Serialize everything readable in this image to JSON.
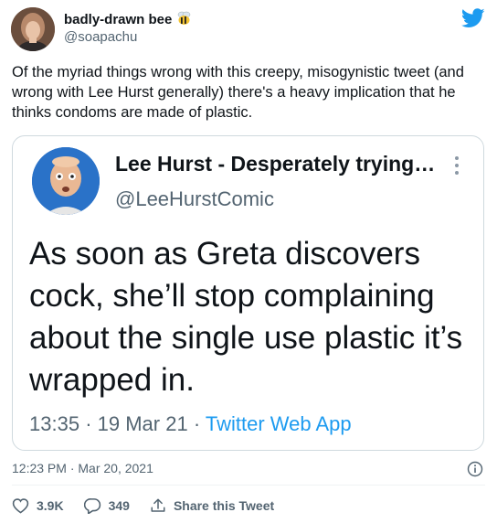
{
  "tweet": {
    "author_name": "badly-drawn bee",
    "author_emoji": "bee-emoji",
    "author_handle": "@soapachu",
    "text": "Of the myriad things wrong with this creepy, misogynistic tweet (and wrong with Lee Hurst generally) there's a heavy implication that he thinks condoms are made of plastic.",
    "timestamp": "12:23 PM · Mar 20, 2021",
    "likes": "3.9K",
    "replies": "349",
    "share_label": "Share this Tweet"
  },
  "quoted_tweet": {
    "author_name": "Lee Hurst - Desperately trying…",
    "author_handle": "@LeeHurstComic",
    "text": "As soon as Greta discovers cock, she’ll stop complaining about the single use plastic it’s wrapped in.",
    "time": "13:35",
    "date": "19 Mar 21",
    "source": "Twitter Web App"
  },
  "colors": {
    "twitter_blue": "#1d9bf0",
    "text_primary": "#0f1419",
    "text_secondary": "#536471",
    "border": "#cfd9de"
  },
  "icons": {
    "brand": "twitter-bird-icon",
    "info": "info-icon",
    "like": "heart-icon",
    "reply": "reply-bubble-icon",
    "share": "share-icon",
    "more": "more-vertical-icon"
  }
}
